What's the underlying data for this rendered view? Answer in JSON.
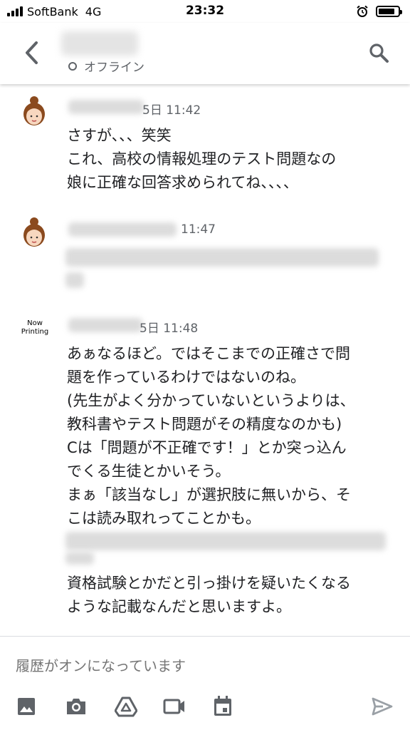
{
  "status_bar": {
    "carrier": "SoftBank",
    "network": "4G",
    "time": "23:32",
    "battery_level": 0.85
  },
  "header": {
    "back_icon": "arrow-back-icon",
    "presence": "オフライン",
    "search_icon": "search-icon"
  },
  "messages": [
    {
      "timestamp": "5日 11:42",
      "text": "さすが、、、笑笑\nこれ、高校の情報処理のテスト問題なの\n娘に正確な回答求められてね、、、、"
    },
    {
      "timestamp": "11:47",
      "text": ""
    },
    {
      "avatar_text": "Now Printing",
      "timestamp": "5日 11:48",
      "text": "あぁなるほど。ではそこまでの正確さで問\n題を作っているわけではないのね。\n(先生がよく分かっていないというよりは、\n教科書やテスト問題がその精度なのかも)\nCは「問題が不正確です！」とか突っ込ん\nでくる生徒とかいそう。\nまぁ「該当なし」が選択肢に無いから、そ\nこは読み取れってことかも。",
      "text_after": "資格試験とかだと引っ掛けを疑いたくなる\nような記載なんだと思いますよ。"
    }
  ],
  "composer": {
    "placeholder": "履歴がオンになっています"
  },
  "toolbar": {
    "icons": [
      "image-icon",
      "camera-icon",
      "drive-icon",
      "video-icon",
      "calendar-icon",
      "send-icon"
    ]
  },
  "colors": {
    "icon": "#5f6368",
    "send": "#9aa0a6",
    "text": "#202124"
  }
}
